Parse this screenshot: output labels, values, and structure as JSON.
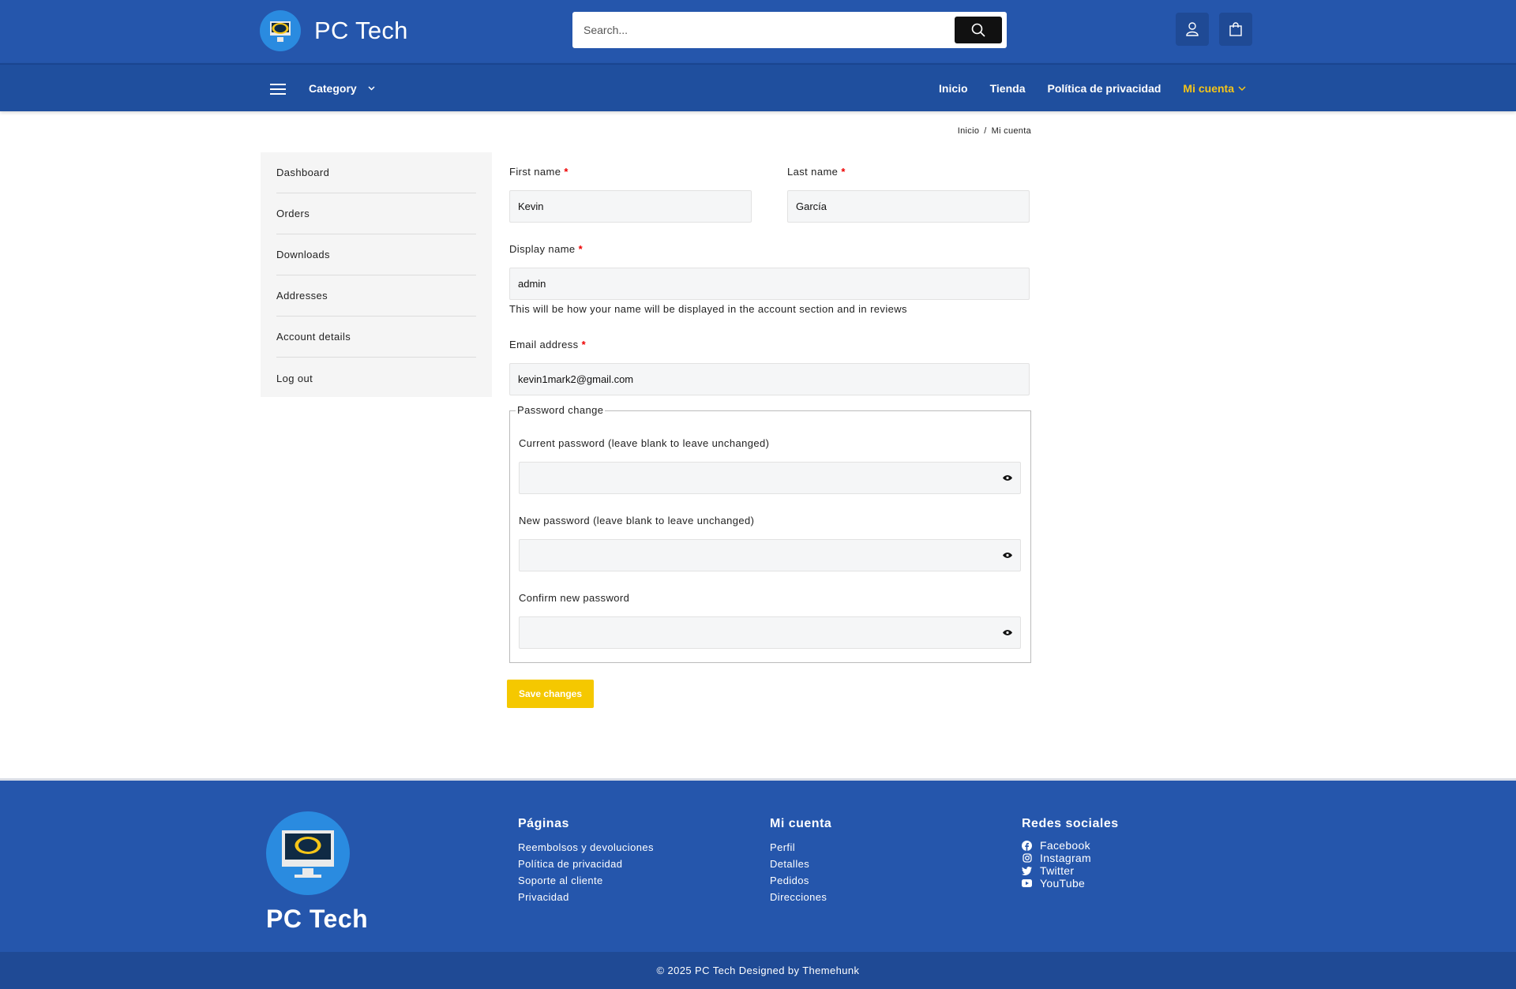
{
  "header": {
    "brand": "PC Tech",
    "search_placeholder": "Search..."
  },
  "nav": {
    "category_label": "Category",
    "links": [
      "Inicio",
      "Tienda",
      "Política de privacidad",
      "Mi cuenta"
    ],
    "active_color": "#f5c518"
  },
  "breadcrumb": {
    "home": "Inicio",
    "separator": "/",
    "current": "Mi cuenta"
  },
  "sidebar": {
    "items": [
      "Dashboard",
      "Orders",
      "Downloads",
      "Addresses",
      "Account details",
      "Log out"
    ]
  },
  "form": {
    "first_name_label": "First name",
    "first_name_value": "Kevin",
    "last_name_label": "Last name",
    "last_name_value": "García",
    "display_name_label": "Display name",
    "display_name_value": "admin",
    "display_name_hint": "This will be how your name will be displayed in the account section and in reviews",
    "email_label": "Email address",
    "email_value": "kevin1mark2@gmail.com",
    "required_mark": "*",
    "password_legend": "Password change",
    "current_password_label": "Current password (leave blank to leave unchanged)",
    "new_password_label": "New password (leave blank to leave unchanged)",
    "confirm_password_label": "Confirm new password",
    "save_label": "Save changes"
  },
  "footer": {
    "brand": "PC Tech",
    "pages": {
      "title": "Páginas",
      "links": [
        "Reembolsos y devoluciones",
        "Política de privacidad",
        "Soporte al cliente",
        "Privacidad"
      ]
    },
    "account": {
      "title": "Mi cuenta",
      "links": [
        "Perfil",
        "Detalles",
        "Pedidos",
        "Direcciones"
      ]
    },
    "social": {
      "title": "Redes sociales",
      "links": [
        "Facebook",
        "Instagram",
        "Twitter",
        "YouTube"
      ]
    },
    "copyright": "© 2025 PC Tech Designed by Themehunk"
  },
  "colors": {
    "primary": "#2556ac",
    "nav": "#1f4f9e",
    "accent": "#f5c518",
    "save_button": "#f5c800"
  }
}
